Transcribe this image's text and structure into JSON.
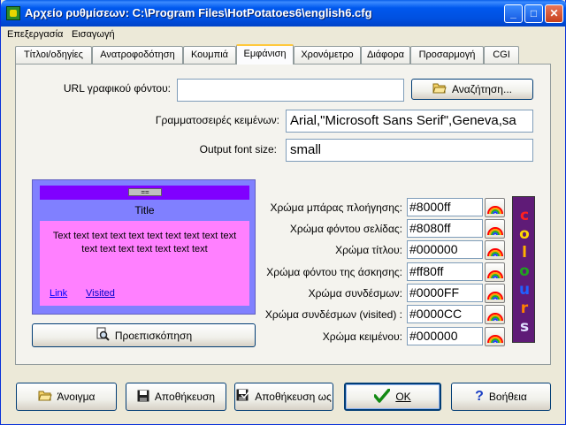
{
  "window": {
    "title": "Αρχείο ρυθμίσεων:  C:\\Program Files\\HotPotatoes6\\english6.cfg",
    "controls": {
      "minimize": "_",
      "maximize": "□",
      "close": "✕"
    }
  },
  "menubar": {
    "items": [
      "Επεξεργασία",
      "Εισαγωγή"
    ]
  },
  "tabs": [
    {
      "label": "Τίτλοι/οδηγίες"
    },
    {
      "label": "Ανατροφοδότηση"
    },
    {
      "label": "Κουμπιά"
    },
    {
      "label": "Εμφάνιση",
      "active": true
    },
    {
      "label": "Χρονόμετρο"
    },
    {
      "label": "Διάφορα"
    },
    {
      "label": "Προσαρμογή"
    },
    {
      "label": "CGI"
    }
  ],
  "appearance": {
    "bg_url_label": "URL γραφικού φόντου:",
    "bg_url_value": "",
    "browse_button": "Αναζήτηση...",
    "fonts_label": "Γραμματοσειρές κειμένων:",
    "fonts_value": "Arial,\"Microsoft Sans Serif\",Geneva,sa",
    "font_size_label": "Output font size:",
    "font_size_value": "small"
  },
  "preview": {
    "nav_button": "==",
    "title": "Title",
    "body_text": "Text text text text text text text text text text text text text text text text text",
    "link": "Link",
    "visited": "Visited",
    "preview_button": "Προεπισκόπηση"
  },
  "colors": [
    {
      "label": "Χρώμα μπάρας πλοήγησης:",
      "value": "#8000ff"
    },
    {
      "label": "Χρώμα φόντου σελίδας:",
      "value": "#8080ff"
    },
    {
      "label": "Χρώμα τίτλου:",
      "value": "#000000"
    },
    {
      "label": "Χρώμα φόντου της άσκησης:",
      "value": "#ff80ff"
    },
    {
      "label": "Χρώμα συνδέσμων:",
      "value": "#0000FF"
    },
    {
      "label": "Χρώμα συνδέσμων (visited) :",
      "value": "#0000CC"
    },
    {
      "label": "Χρώμα κειμένου:",
      "value": "#000000"
    }
  ],
  "colours_logo": {
    "letters": [
      "c",
      "o",
      "l",
      "o",
      "u",
      "r",
      "s"
    ],
    "letter_colors": [
      "#ff2020",
      "#ffd800",
      "#ffb000",
      "#20a020",
      "#2060ff",
      "#ff8000",
      "#e0e0ff"
    ]
  },
  "bottom_buttons": {
    "open": "Άνοιγμα",
    "save": "Αποθήκευση",
    "save_as": "Αποθήκευση ως",
    "ok": "OK",
    "help": "Βοήθεια"
  }
}
